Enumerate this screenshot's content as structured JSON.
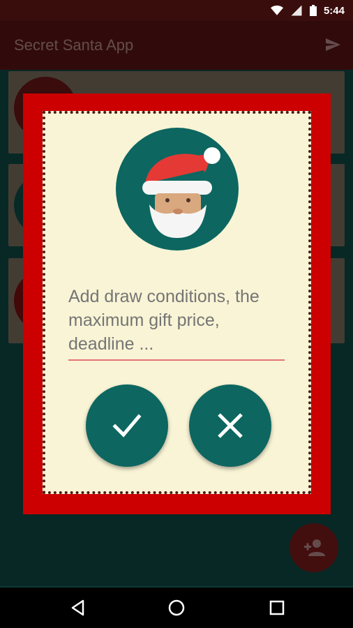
{
  "status_bar": {
    "time": "5:44"
  },
  "app_bar": {
    "title": "Secret Santa App",
    "send_icon": "send-icon"
  },
  "dialog": {
    "message": "Add draw conditions, the maximum gift price, deadline ...",
    "confirm_icon": "check-icon",
    "cancel_icon": "close-icon",
    "avatar_icon": "santa-icon"
  },
  "fab": {
    "icon": "add-person-icon"
  },
  "nav_bar": {
    "back_icon": "back-icon",
    "home_icon": "home-icon",
    "recents_icon": "recents-icon"
  },
  "colors": {
    "primary": "#5a1414",
    "dialog_frame": "#cc0000",
    "dialog_bg": "#f8f4d5",
    "accent_teal": "#0d6660",
    "underline": "#e57373"
  }
}
